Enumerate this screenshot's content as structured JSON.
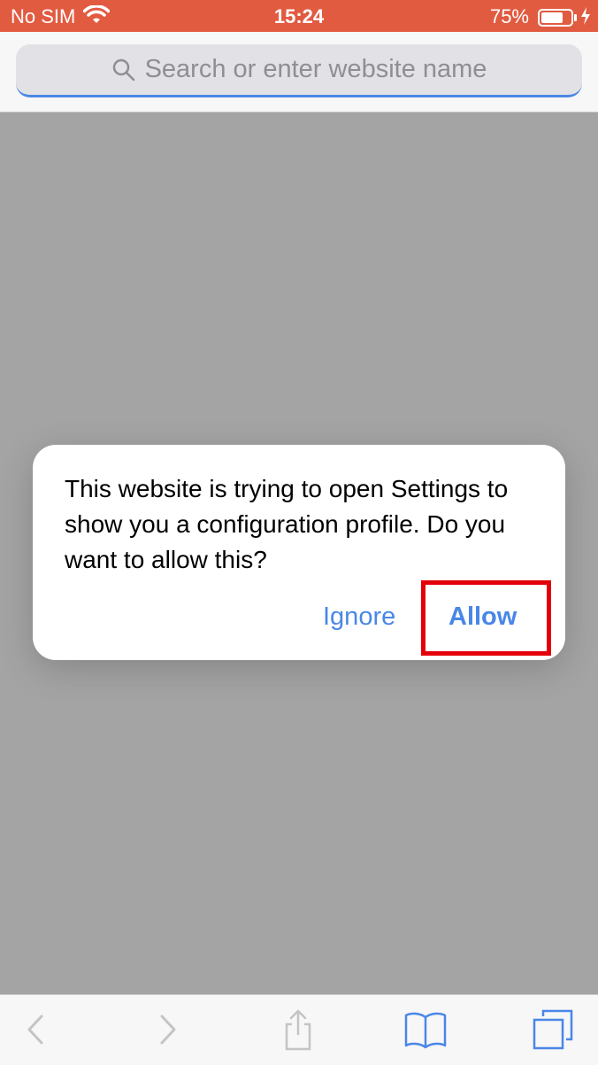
{
  "status_bar": {
    "carrier": "No SIM",
    "time": "15:24",
    "battery_percent": "75%",
    "battery_level": 0.75,
    "background_color": "#e15b41",
    "wifi_icon": "wifi-icon",
    "charging_icon": "charging-bolt-icon"
  },
  "browser": {
    "search_placeholder": "Search or enter website name",
    "search_icon": "search-icon"
  },
  "dialog": {
    "message": "This website is trying to open Settings to show you a configuration profile. Do you want to allow this?",
    "ignore_label": "Ignore",
    "allow_label": "Allow",
    "button_color": "#4a86e8",
    "highlight_color": "#e3000b"
  },
  "toolbar": {
    "items": [
      {
        "icon": "back-icon",
        "enabled": false
      },
      {
        "icon": "forward-icon",
        "enabled": false
      },
      {
        "icon": "share-icon",
        "enabled": false
      },
      {
        "icon": "bookmarks-icon",
        "enabled": true
      },
      {
        "icon": "tabs-icon",
        "enabled": true
      }
    ]
  }
}
